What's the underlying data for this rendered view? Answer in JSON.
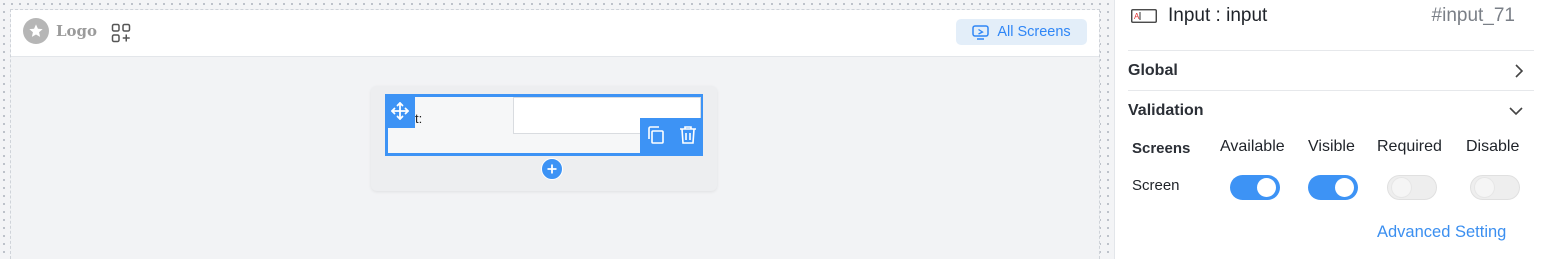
{
  "canvas": {
    "logo_text": "Logo",
    "all_screens_label": "All Screens",
    "widget": {
      "label": "t:",
      "input_value": ""
    }
  },
  "panel": {
    "title": "Input : input",
    "element_id": "#input_71",
    "sections": {
      "global": "Global",
      "validation": "Validation"
    },
    "validation": {
      "columns": [
        "Screens",
        "Available",
        "Visible",
        "Required",
        "Disable"
      ],
      "rows": [
        {
          "label": "Screen",
          "available": true,
          "visible": true,
          "required": false,
          "disable": false
        }
      ]
    },
    "advanced_setting_label": "Advanced Setting"
  },
  "colors": {
    "accent": "#3d93f5",
    "link": "#3b8ff0"
  }
}
